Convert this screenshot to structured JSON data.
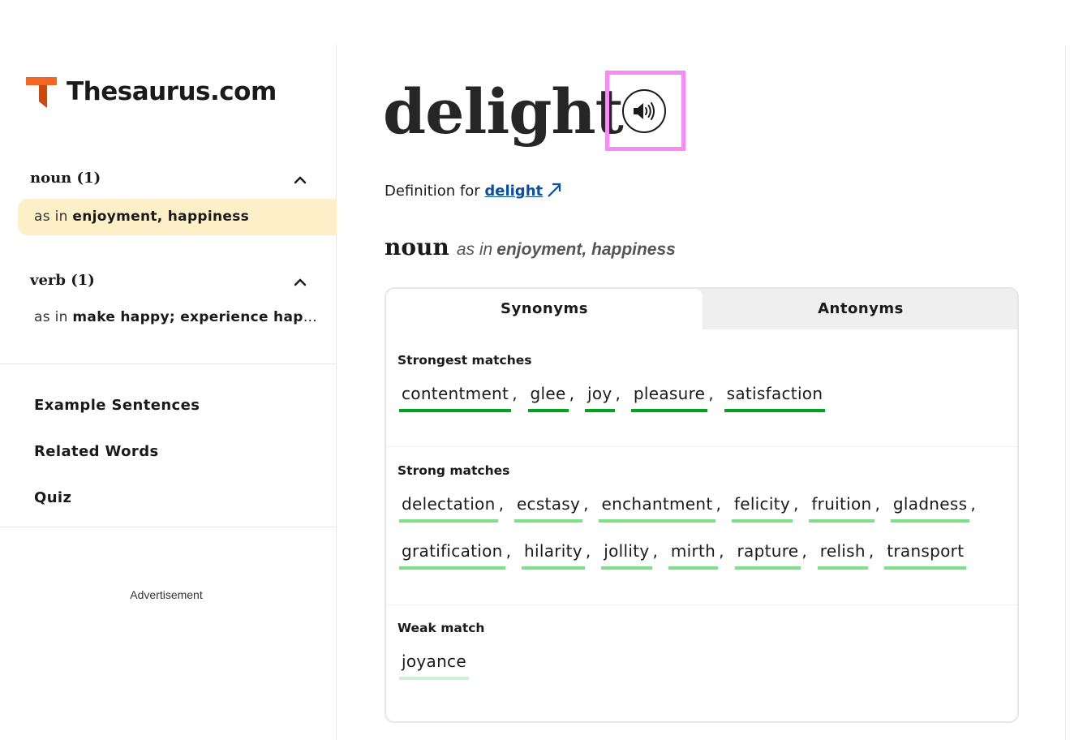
{
  "brand": {
    "name": "Thesaurus.com",
    "color": "#f26722"
  },
  "sidebar": {
    "noun_heading": "noun (1)",
    "noun_sense_prefix": "as in",
    "noun_sense": "enjoyment, happiness",
    "verb_heading": "verb (1)",
    "verb_sense_prefix": "as in",
    "verb_sense": "make happy; experience happiness",
    "links": [
      "Example Sentences",
      "Related Words",
      "Quiz"
    ],
    "advertisement": "Advertisement"
  },
  "entry": {
    "word": "delight",
    "definition_prefix": "Definition for",
    "definition_link": "delight",
    "pos": "noun",
    "pos_asin": "as in",
    "pos_sense": "enjoyment, happiness"
  },
  "tabs": {
    "synonyms": "Synonyms",
    "antonyms": "Antonyms",
    "active": "Synonyms"
  },
  "groups": {
    "strongest": {
      "title": "Strongest matches",
      "words": [
        "contentment",
        "glee",
        "joy",
        "pleasure",
        "satisfaction"
      ]
    },
    "strong": {
      "title": "Strong matches",
      "row1": [
        "delectation",
        "ecstasy",
        "enchantment",
        "felicity",
        "fruition",
        "gladness"
      ],
      "row2": [
        "gratification",
        "hilarity",
        "jollity",
        "mirth",
        "rapture",
        "relish",
        "transport"
      ]
    },
    "weak": {
      "title": "Weak match",
      "words": [
        "joyance"
      ]
    }
  },
  "colors": {
    "strongest_underline": "#00a31e",
    "strong_underline": "#7fe08a",
    "weak_underline": "#cdf2d1",
    "active_sense_bg": "#fdefc8",
    "link": "#0b4ea2",
    "highlight_box": "#f78bf3"
  }
}
